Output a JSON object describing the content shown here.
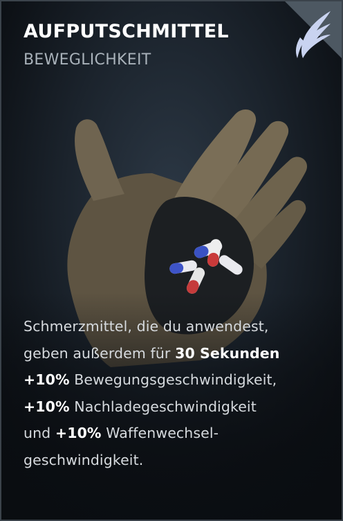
{
  "card": {
    "title": "AUFPUTSCHMITTEL",
    "subtitle": "BEWEGLICHKEIT",
    "emblem_icon": "winged-emblem-icon",
    "image_icon": "gloved-hand-with-pills-icon",
    "accent_color": "#c9d3f0"
  },
  "description": {
    "line1": "Schmerzmittel, die du anwendest,",
    "line2_text": "geben außerdem für ",
    "line2_highlight": "30 Sekunden",
    "line3_highlight": "+10%",
    "line3_text": " Bewegungsgeschwindigkeit,",
    "line4_highlight": "+10%",
    "line4_text": " Nachladegeschwindigkeit",
    "line5_text": "und ",
    "line5_highlight": "+10%",
    "line5_text2": " Waffenwechsel-",
    "line6_text": "geschwindigkeit."
  }
}
